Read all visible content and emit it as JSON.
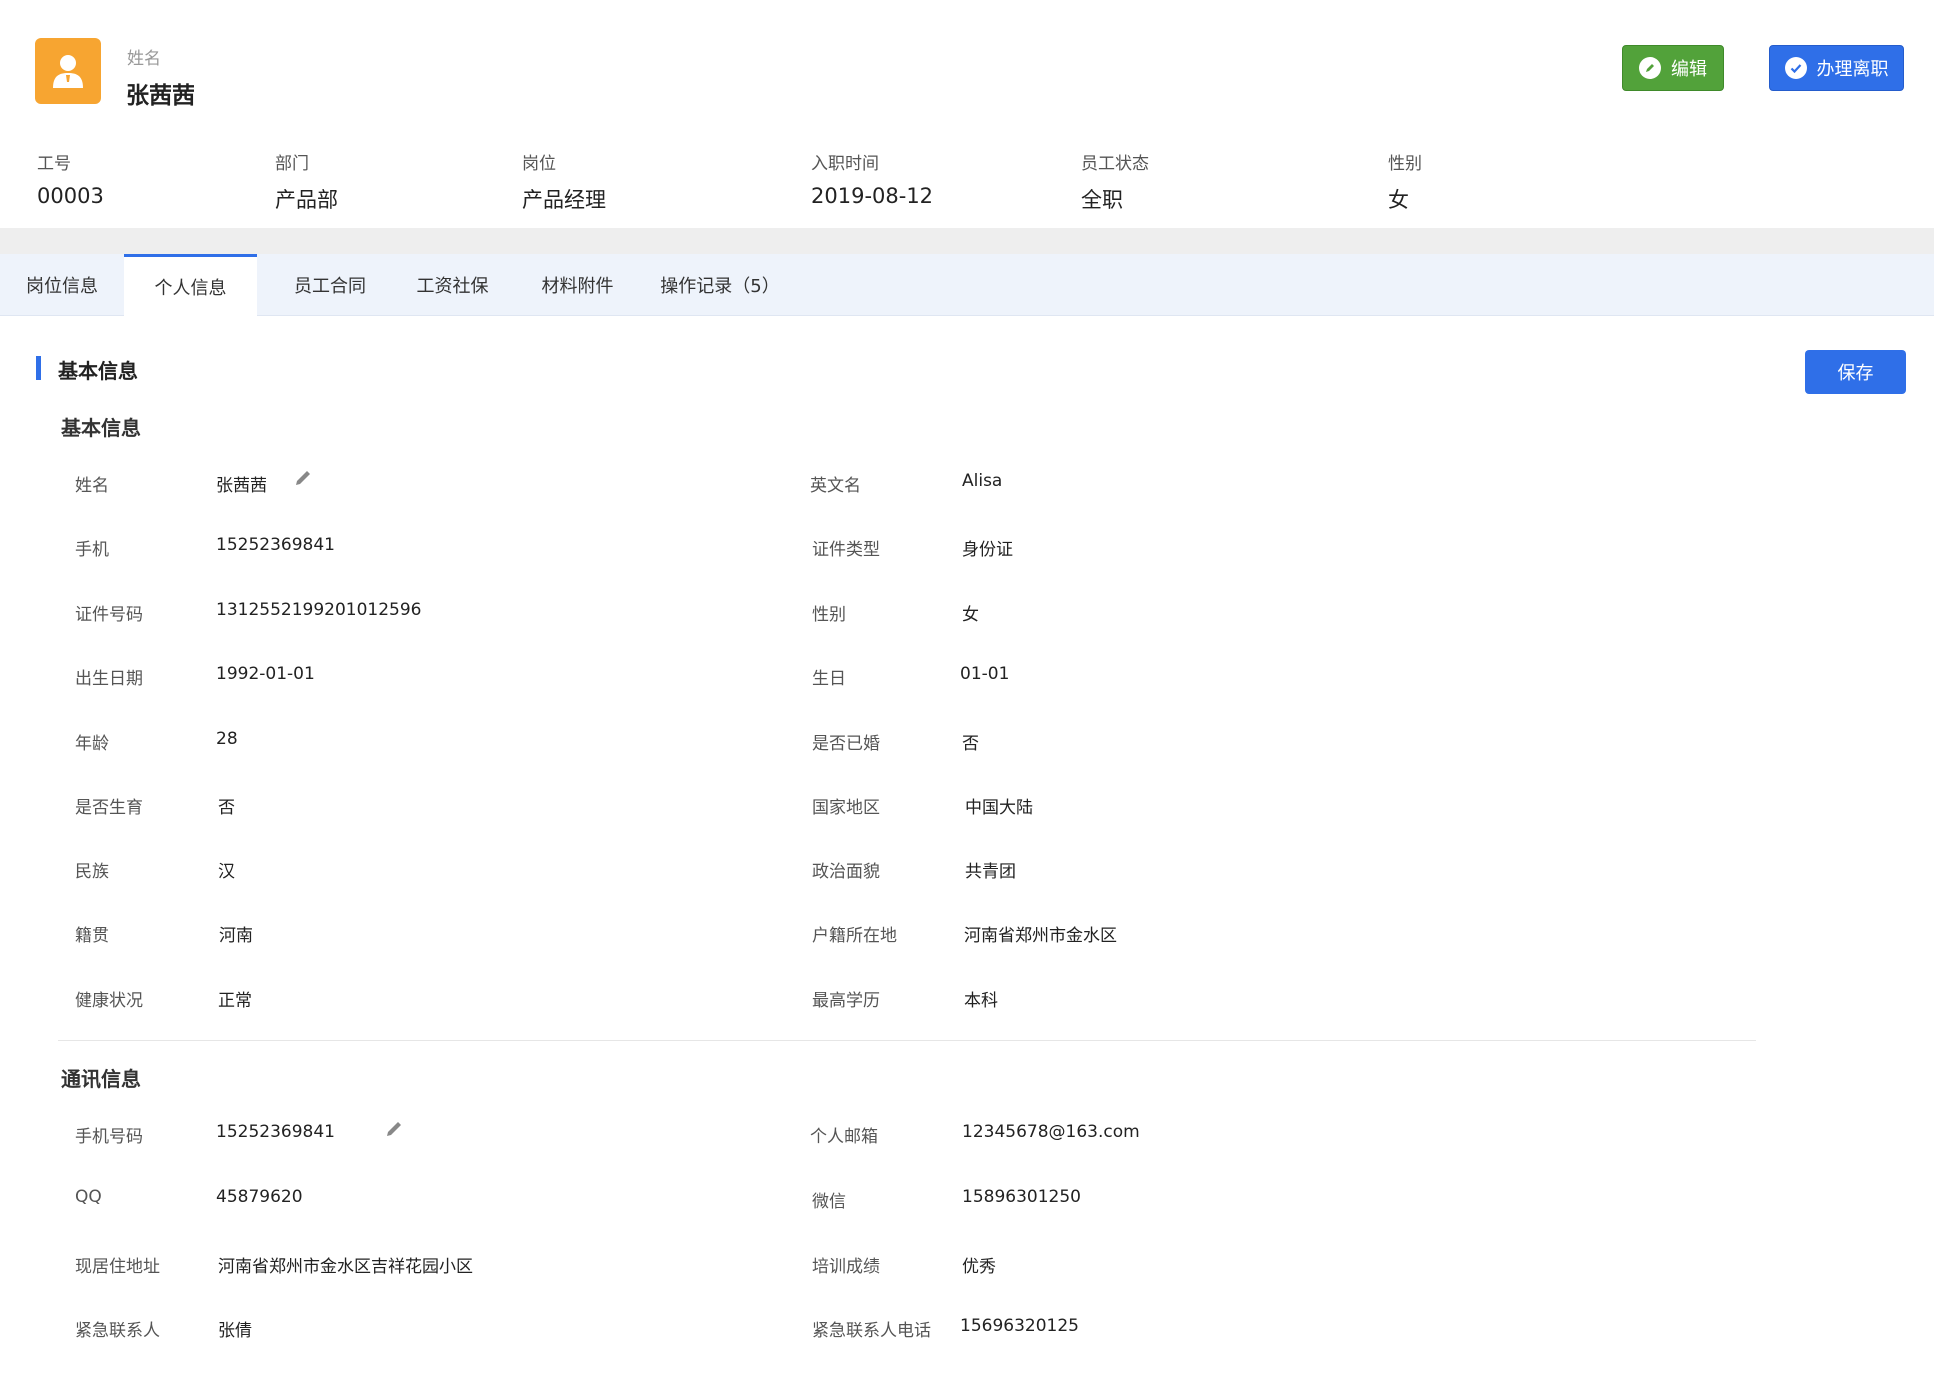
{
  "header": {
    "name_label": "姓名",
    "name": "张茜茜",
    "edit_label": "编辑",
    "leave_label": "办理离职"
  },
  "summary": [
    {
      "label": "工号",
      "value": "00003"
    },
    {
      "label": "部门",
      "value": "产品部"
    },
    {
      "label": "岗位",
      "value": "产品经理"
    },
    {
      "label": "入职时间",
      "value": "2019-08-12"
    },
    {
      "label": "员工状态",
      "value": "全职"
    },
    {
      "label": "性别",
      "value": "女"
    }
  ],
  "tabs": [
    {
      "label": "岗位信息"
    },
    {
      "label": "个人信息"
    },
    {
      "label": "员工合同"
    },
    {
      "label": "工资社保"
    },
    {
      "label": "材料附件"
    },
    {
      "label": "操作记录（5）"
    }
  ],
  "active_tab": "个人信息",
  "section": {
    "title": "基本信息",
    "save_label": "保存"
  },
  "basic": {
    "title": "基本信息",
    "rows": [
      {
        "l1": "姓名",
        "v1": "张茜茜",
        "l2": "英文名",
        "v2": "Alisa"
      },
      {
        "l1": "手机",
        "v1": "15252369841",
        "l2": "证件类型",
        "v2": "身份证"
      },
      {
        "l1": "证件号码",
        "v1": "1312552199201012596",
        "l2": "性别",
        "v2": "女"
      },
      {
        "l1": "出生日期",
        "v1": "1992-01-01",
        "l2": "生日",
        "v2": "01-01"
      },
      {
        "l1": "年龄",
        "v1": "28",
        "l2": "是否已婚",
        "v2": "否"
      },
      {
        "l1": "是否生育",
        "v1": "否",
        "l2": "国家地区",
        "v2": "中国大陆"
      },
      {
        "l1": "民族",
        "v1": "汉",
        "l2": "政治面貌",
        "v2": "共青团"
      },
      {
        "l1": "籍贯",
        "v1": "河南",
        "l2": "户籍所在地",
        "v2": "河南省郑州市金水区"
      },
      {
        "l1": "健康状况",
        "v1": "正常",
        "l2": "最高学历",
        "v2": "本科"
      }
    ]
  },
  "contact": {
    "title": "通讯信息",
    "rows": [
      {
        "l1": "手机号码",
        "v1": "15252369841",
        "l2": "个人邮箱",
        "v2": "12345678@163.com"
      },
      {
        "l1": "QQ",
        "v1": "45879620",
        "l2": "微信",
        "v2": "15896301250"
      },
      {
        "l1": "现居住地址",
        "v1": "河南省郑州市金水区吉祥花园小区",
        "l2": "培训成绩",
        "v2": "优秀"
      },
      {
        "l1": "紧急联系人",
        "v1": "张倩",
        "l2": "紧急联系人电话",
        "v2": "15696320125"
      }
    ]
  },
  "colors": {
    "primary": "#2f6fe8",
    "edit_green": "#52a23a",
    "avatar_orange": "#f7a531",
    "tabbar_bg": "#eef3fb"
  },
  "icons": {
    "avatar": "user-badge-icon",
    "edit": "pencil-circle-icon",
    "leave": "check-circle-icon",
    "field_edit": "pencil-icon"
  }
}
